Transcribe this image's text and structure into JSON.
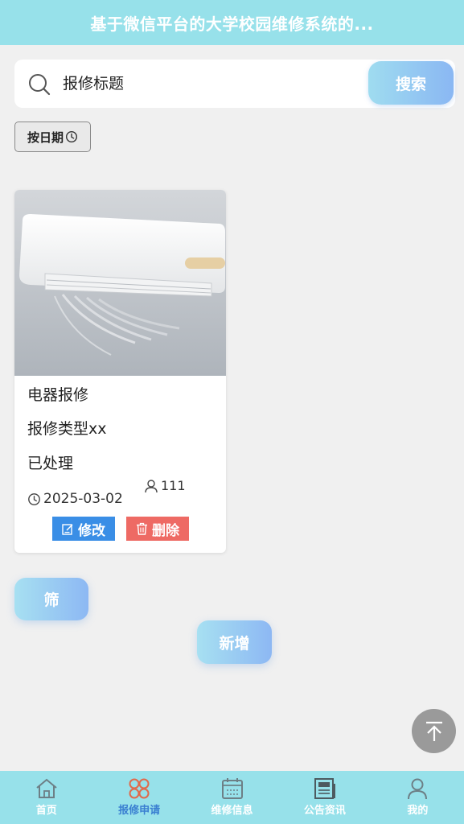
{
  "header": {
    "title": "基于微信平台的大学校园维修系统的..."
  },
  "search": {
    "placeholder": "报修标题",
    "button_label": "搜索"
  },
  "sort": {
    "label": "按日期"
  },
  "card": {
    "title": "电器报修",
    "type": "报修类型xx",
    "status": "已处理",
    "date": "2025-03-02",
    "user": "111",
    "edit_label": "修改",
    "delete_label": "删除"
  },
  "actions": {
    "filter_label": "筛",
    "add_label": "新增"
  },
  "tabs": [
    {
      "label": "首页",
      "icon": "home-icon"
    },
    {
      "label": "报修申请",
      "icon": "grid-icon",
      "active": true
    },
    {
      "label": "维修信息",
      "icon": "calendar-icon"
    },
    {
      "label": "公告资讯",
      "icon": "news-icon"
    },
    {
      "label": "我的",
      "icon": "user-icon"
    }
  ],
  "colors": {
    "header_bg": "#97e1ea",
    "edit_btn": "#3a8ee6",
    "delete_btn": "#ee6a64",
    "tab_active": "#3a7fd1"
  }
}
